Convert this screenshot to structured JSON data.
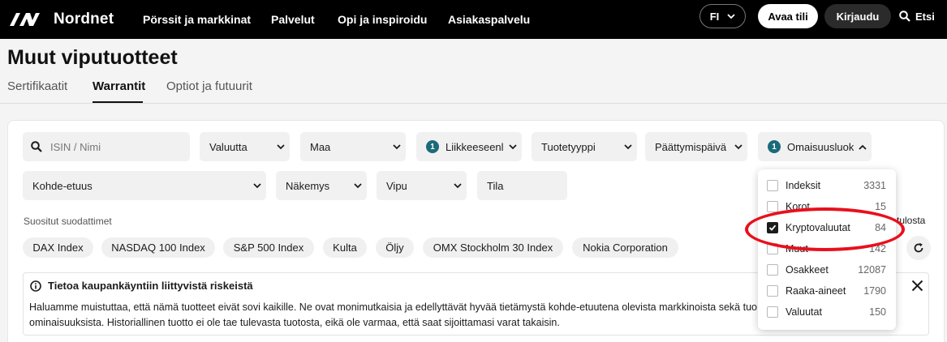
{
  "nav": {
    "brand": "Nordnet",
    "links": [
      "Pörssit ja markkinat",
      "Palvelut",
      "Opi ja inspiroidu",
      "Asiakaspalvelu"
    ],
    "lang": "FI",
    "open_account": "Avaa tili",
    "login": "Kirjaudu",
    "search": "Etsi"
  },
  "page": {
    "title": "Muut viputuotteet",
    "tabs": [
      "Sertifikaatit",
      "Warrantit",
      "Optiot ja futuurit"
    ],
    "active_tab": "Warrantit"
  },
  "filters": {
    "search_placeholder": "ISIN / Nimi",
    "valuutta": "Valuutta",
    "maa": "Maa",
    "liikkeeseenlaskija": "Liikkeeseenlaskija",
    "liikkeeseenlaskija_badge": "1",
    "tuotetyyppi": "Tuotetyyppi",
    "paattymispaiva": "Päättymispäivä",
    "omaisuusluokka": "Omaisuusluokka",
    "omaisuusluokka_badge": "1",
    "kohde_etuus": "Kohde-etuus",
    "nakemys": "Näkemys",
    "vipu": "Vipu",
    "tila": "Tila"
  },
  "suggested": {
    "title": "Suositut suodattimet",
    "chips": [
      "DAX Index",
      "NASDAQ 100 Index",
      "S&P 500 Index",
      "Kulta",
      "Öljy",
      "OMX Stockholm 30 Index",
      "Nokia Corporation"
    ],
    "results_partial": "tulosta"
  },
  "risk": {
    "title": "Tietoa kaupankäyntiin liittyvistä riskeistä",
    "line1": "Haluamme muistuttaa, että nämä tuotteet eivät sovi kaikille. Ne ovat monimutkaisia ja edellyttävät hyvää tietämystä kohde-etuutena olevista markkinoista sekä tuo",
    "line2": "ominaisuuksista. Historiallinen tuotto ei ole tae tulevasta tuotosta, eikä ole varmaa, että saat sijoittamasi varat takaisin."
  },
  "dropdown": {
    "options": [
      {
        "label": "Indeksit",
        "count": "3331",
        "checked": false
      },
      {
        "label": "Korot",
        "count": "15",
        "checked": false
      },
      {
        "label": "Kryptovaluutat",
        "count": "84",
        "checked": true
      },
      {
        "label": "Muut",
        "count": "142",
        "checked": false
      },
      {
        "label": "Osakkeet",
        "count": "12087",
        "checked": false
      },
      {
        "label": "Raaka-aineet",
        "count": "1790",
        "checked": false
      },
      {
        "label": "Valuutat",
        "count": "150",
        "checked": false
      }
    ]
  },
  "colors": {
    "nav_bg": "#000000",
    "badge": "#1a6b7a",
    "annotation": "#e8101c"
  }
}
